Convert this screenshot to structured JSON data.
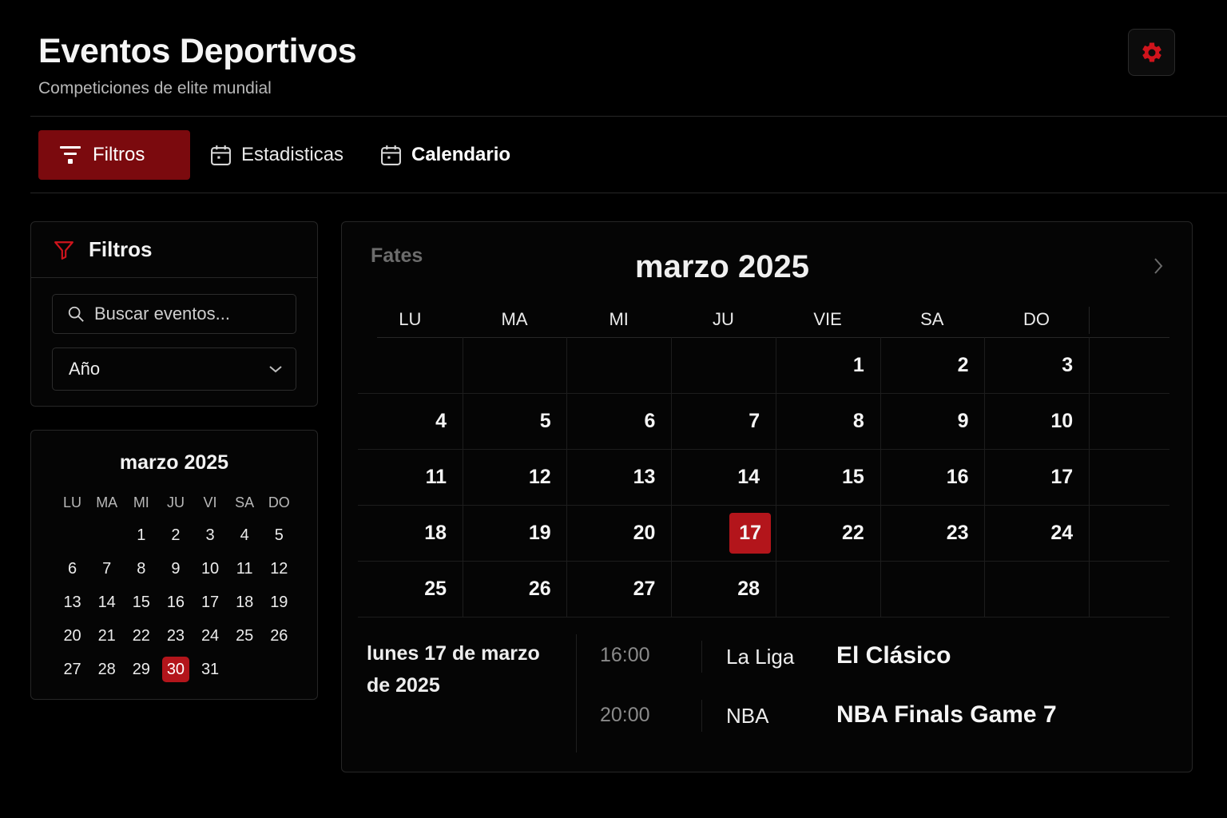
{
  "header": {
    "title": "Eventos Deportivos",
    "subtitle": "Competiciones de elite mundial"
  },
  "colors": {
    "accent": "#b3151b",
    "accent_dark": "#7b0a0e",
    "background": "#000000"
  },
  "nav": {
    "tabs": [
      {
        "label": "Filtros",
        "icon": "filter-icon",
        "active": true
      },
      {
        "label": "Estadisticas",
        "icon": "calendar-icon",
        "active": false
      },
      {
        "label": "Calendario",
        "icon": "calendar-icon",
        "active": false
      }
    ]
  },
  "filters": {
    "title": "Filtros",
    "search_placeholder": "Buscar eventos...",
    "year_label": "Año"
  },
  "mini_calendar": {
    "title": "marzo 2025",
    "weekdays": [
      "LU",
      "MA",
      "MI",
      "JU",
      "VI",
      "SA",
      "DO"
    ],
    "days": [
      [
        "",
        "",
        "1",
        "2",
        "3",
        "4",
        "5"
      ],
      [
        "6",
        "7",
        "8",
        "9",
        "10",
        "11",
        "12"
      ],
      [
        "13",
        "14",
        "15",
        "16",
        "17",
        "18",
        "19"
      ],
      [
        "20",
        "21",
        "22",
        "23",
        "24",
        "25",
        "26"
      ],
      [
        "27",
        "28",
        "29",
        "30",
        "31",
        "",
        ""
      ]
    ],
    "selected": "30"
  },
  "main_calendar": {
    "side_label": "Fates",
    "title": "marzo 2025",
    "weekdays": [
      "LU",
      "MA",
      "MI",
      "JU",
      "VIE",
      "SA",
      "DO"
    ],
    "weeks": [
      [
        "",
        "",
        "",
        "",
        "1",
        "2",
        "3"
      ],
      [
        "4",
        "5",
        "6",
        "7",
        "8",
        "9",
        "10"
      ],
      [
        "11",
        "12",
        "13",
        "14",
        "15",
        "16",
        "17"
      ],
      [
        "18",
        "19",
        "20",
        "17",
        "22",
        "23",
        "24"
      ],
      [
        "25",
        "26",
        "27",
        "28",
        "",
        "",
        ""
      ]
    ],
    "highlight": {
      "week": 3,
      "day": 3
    }
  },
  "events": {
    "date_line1": "lunes 17 de marzo",
    "date_line2": "de 2025",
    "items": [
      {
        "time": "16:00",
        "league": "La Liga",
        "name": "El Clásico"
      },
      {
        "time": "20:00",
        "league": "NBA",
        "name": "NBA Finals Game 7"
      }
    ]
  }
}
